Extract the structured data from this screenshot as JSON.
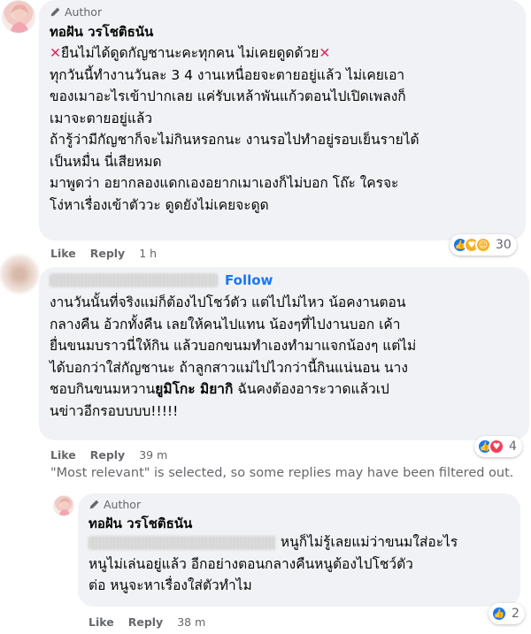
{
  "comment1": {
    "author_tag": "Author",
    "name": "ทอฝัน วรโชติธนัน",
    "lines": [
      "ยืนไม่ได้ดูดกัญชานะคะทุกคน ไม่เคยดูดด้วย",
      "ทุกวันนี้ทำงานวันละ 3 4 งานเหนื่อยจะตายอยู่แล้ว ไม่เคยเอา",
      "ของเมาอะไรเข้าปากเลย แค่รับเหล้าพันแก้วตอนไปเปิดเพลงก็",
      "เมาจะตายอยู่แล้ว",
      "ถ้ารู้ว่ามีกัญชาก็จะไม่กินหรอกนะ งานรอไปทำอยู่รอบเย็นรายได้",
      "เป็นหมื่น นี่เสียหมด",
      "มาพูดว่า อยากลองแดกเองอยากเมาเองก็ไม่บอก โถ๊ะ ใครจะ",
      "โง่หาเรื่องเข้าตัววะ ดูดยังไม่เคยจะดูด"
    ],
    "like": "Like",
    "reply": "Reply",
    "time": "1 h",
    "reaction_count": "30"
  },
  "comment2": {
    "follow": "Follow",
    "lines": [
      "งานวันนั้นที่จริงแม่ก็ต้องไปโชว์ตัว แต่ไปไม่ไหว น้อคงานตอน",
      "กลางคืน อ้วกทั้งคืน เลยให้คนไปแทน น้องๆที่ไปงานบอก เค้า",
      "ยื่นขนมบราวนี่ให้กิน แล้วบอกขนมทำเองทำมาแจกน้องๆ แต่ไม่",
      "ได้บอกว่าใส่กัญชานะ ถ้าลูกสาวแม่ไปไวกว่านี้กินแน่นอน นาง"
    ],
    "line5_pre": "ชอบกินขนมหวาน",
    "line5_bold": "ยูมิโกะ มิยากิ",
    "line5_post": " ฉันคงต้องอาระวาดแล้วเป",
    "line6": "นข่าวอีกรอบบบบ!!!!!",
    "like": "Like",
    "reply": "Reply",
    "time": "39 m",
    "reaction_count": "4"
  },
  "notice": "\"Most relevant\" is selected, so some replies may have been filtered out.",
  "comment3": {
    "author_tag": "Author",
    "name": "ทอฝัน วรโชติธนัน",
    "line1_post": " หนูก็ไม่รู้เลยแม่ว่าขนมใส่อะไร",
    "lines": [
      "หนูไม่เล่นอยู่แล้ว อีกอย่างตอนกลางคืนหนูต้องไปโชว์ตัว",
      "ต่อ หนูจะหาเรื่องใส่ตัวทำไม"
    ],
    "like": "Like",
    "reply": "Reply",
    "time": "38 m",
    "reaction_count": "2"
  },
  "icons": {
    "author_badge": "pencil-icon",
    "cross": "cross-mark-icon",
    "reactions1": [
      "like-icon",
      "care-icon",
      "haha-icon"
    ],
    "reactions2": [
      "like-icon",
      "love-icon"
    ],
    "reactions3": [
      "like-icon"
    ]
  }
}
